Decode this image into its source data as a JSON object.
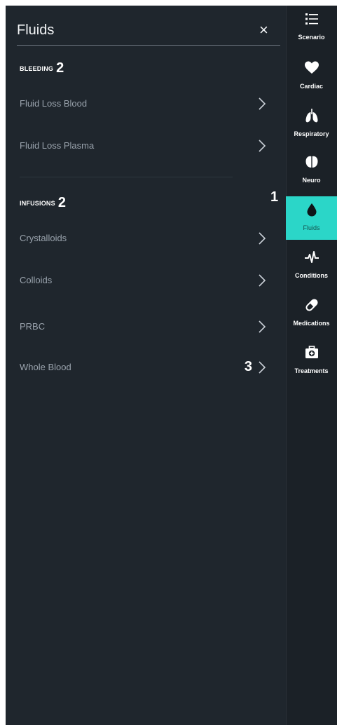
{
  "panel": {
    "title": "Fluids",
    "close_glyph": "×",
    "sections": [
      {
        "label": "BLEEDING",
        "callout": "2",
        "items": [
          {
            "label": "Fluid Loss Blood"
          },
          {
            "label": "Fluid Loss Plasma"
          }
        ]
      },
      {
        "label": "INFUSIONS",
        "callout": "2",
        "items": [
          {
            "label": "Crystalloids"
          },
          {
            "label": "Colloids"
          },
          {
            "label": "PRBC"
          },
          {
            "label": "Whole Blood",
            "callout": "3"
          }
        ]
      }
    ]
  },
  "callout_active": "1",
  "sidebar": {
    "items": [
      {
        "label": "Scenario",
        "icon": "list-icon"
      },
      {
        "label": "Cardiac",
        "icon": "heart-icon"
      },
      {
        "label": "Respiratory",
        "icon": "lungs-icon"
      },
      {
        "label": "Neuro",
        "icon": "brain-icon"
      },
      {
        "label": "Fluids",
        "icon": "droplet-icon",
        "active": true
      },
      {
        "label": "Conditions",
        "icon": "pulse-icon"
      },
      {
        "label": "Medications",
        "icon": "pill-icon"
      },
      {
        "label": "Treatments",
        "icon": "first-aid-kit-icon"
      }
    ]
  },
  "colors": {
    "accent": "#2bd6c8",
    "panel_bg": "#1f262d",
    "rail_bg": "#1b2127"
  }
}
